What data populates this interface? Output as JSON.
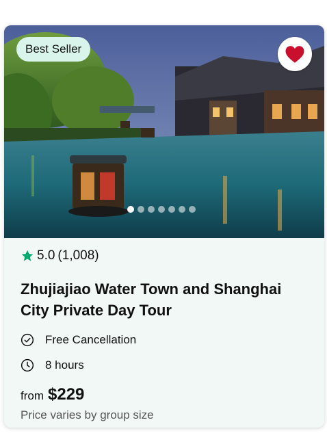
{
  "card": {
    "badge": "Best Seller",
    "rating": {
      "score": "5.0",
      "count": "(1,008)"
    },
    "title": "Zhujiajiao Water Town and Shanghai City Private Day Tour",
    "features": [
      {
        "icon": "check-circle-icon",
        "label": "Free Cancellation"
      },
      {
        "icon": "clock-icon",
        "label": "8 hours"
      }
    ],
    "price": {
      "prefix": "from",
      "amount": "$229"
    },
    "price_note": "Price varies by group size",
    "carousel": {
      "count": 7,
      "active_index": 0
    },
    "favorite_icon": "heart-icon",
    "colors": {
      "accent": "#00aa6c",
      "heart": "#c8102e",
      "badge_bg": "#d9f4ea",
      "card_bg": "#f1f8f6"
    }
  }
}
